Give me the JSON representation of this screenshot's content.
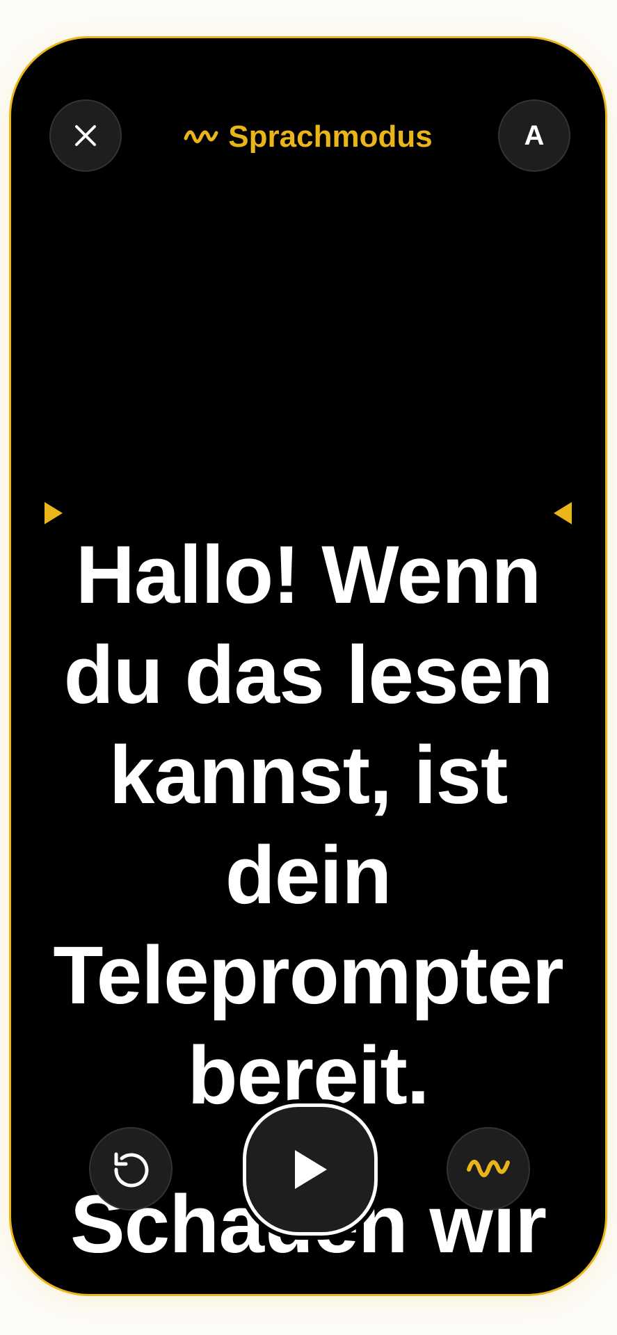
{
  "header": {
    "close_icon": "close-icon",
    "mode_icon": "waveform-icon",
    "mode_label": "Sprachmodus",
    "font_button_label": "A"
  },
  "script": {
    "paragraph_1": "Hallo! Wenn du das lesen kannst, ist dein Teleprompter bereit.",
    "paragraph_2": "Schauen wir"
  },
  "controls": {
    "restart_icon": "restart-icon",
    "play_icon": "play-icon",
    "voice_icon": "waveform-icon"
  },
  "colors": {
    "accent": "#e9b51a",
    "background": "#000000",
    "text": "#ffffff",
    "button_bg": "#1e1e1f"
  }
}
